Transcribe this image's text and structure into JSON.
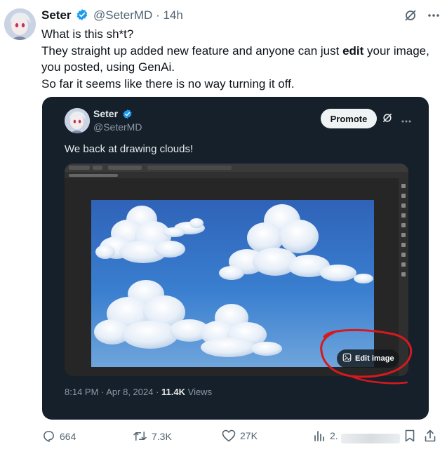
{
  "tweet": {
    "display_name": "Seter",
    "handle": "@SeterMD",
    "time": "· 14h",
    "lines": [
      "What is this sh*t?",
      "They straight up added new feature and anyone can just ",
      "edit",
      " your image, you posted, using GenAi.",
      "So far it seems like there is no way turning it off."
    ]
  },
  "quoted": {
    "display_name": "Seter",
    "handle": "@SeterMD",
    "promote_label": "Promote",
    "text": "We back at drawing clouds!",
    "edit_image_label": "Edit image",
    "timestamp": "8:14 PM · Apr 8, 2024 · ",
    "views_count": "11.4K",
    "views_label": " Views"
  },
  "actions": {
    "replies": "664",
    "reposts": "7.3K",
    "likes": "27K",
    "views": "2."
  },
  "colors": {
    "verified_blue": "#1d9bf0",
    "annotation_red": "#d5191d",
    "card_bg": "#15202b"
  }
}
